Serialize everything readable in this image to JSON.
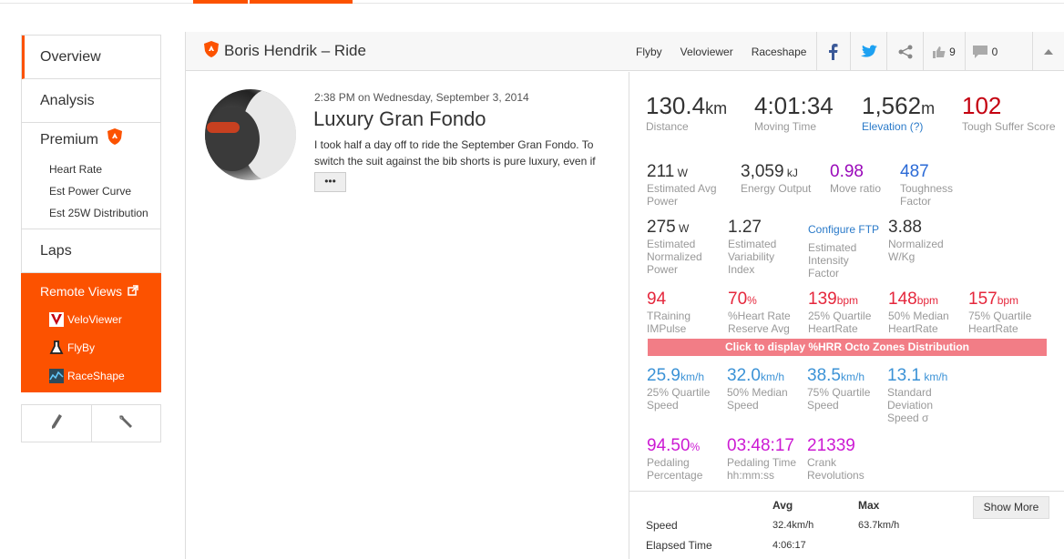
{
  "colors": {
    "accent": "#fc5200",
    "blue_link": "#2a7ac9",
    "suffer_red": "#c40010",
    "hr_red": "#e5273c",
    "purple": "#9a0aba",
    "bar_pink": "#f27d86"
  },
  "sidebar": {
    "overview": "Overview",
    "analysis": "Analysis",
    "premium": "Premium",
    "premium_items": [
      "Heart Rate",
      "Est Power Curve",
      "Est 25W Distribution"
    ],
    "laps": "Laps",
    "remote_title": "Remote Views",
    "remote_items": [
      "VeloViewer",
      "FlyBy",
      "RaceShape"
    ],
    "tool_icons": [
      "pencil-icon",
      "wrench-icon"
    ]
  },
  "header": {
    "title": "Boris Hendrik – Ride",
    "links": [
      "Flyby",
      "Veloviewer",
      "Raceshape"
    ],
    "kudos_count": "9",
    "comment_count": "0"
  },
  "activity": {
    "datetime": "2:38 PM on Wednesday, September 3, 2014",
    "title": "Luxury Gran Fondo",
    "description": "I took half a day off to ride the September Gran Fondo. To switch the suit against the bib shorts is pure luxury, even if",
    "more": "•••"
  },
  "stats": {
    "distance": {
      "value": "130.4",
      "unit": "km",
      "label": "Distance"
    },
    "moving_time": {
      "value": "4:01:34",
      "label": "Moving Time"
    },
    "elevation": {
      "value": "1,562",
      "unit": "m",
      "label": "Elevation (?)"
    },
    "suffer": {
      "value": "102",
      "label": "Tough Suffer Score"
    },
    "row2": [
      {
        "value": "211",
        "unit": "W",
        "label": "Estimated Avg Power"
      },
      {
        "value": "3,059",
        "unit": "kJ",
        "label": "Energy Output"
      },
      {
        "value": "0.98",
        "unit": "",
        "label": "Move ratio"
      },
      {
        "value": "487",
        "unit": "",
        "label": "Toughness Factor"
      }
    ],
    "row3": [
      {
        "value": "275",
        "unit": "W",
        "label": "Estimated Normalized Power"
      },
      {
        "value": "1.27",
        "unit": "",
        "label": "Estimated Variability Index"
      },
      {
        "value": "Configure FTP",
        "unit": "",
        "label": "Estimated Intensity Factor"
      },
      {
        "value": "3.88",
        "unit": "",
        "label": "Normalized W/Kg"
      }
    ],
    "row4": [
      {
        "value": "94",
        "unit": "",
        "label": "TRaining IMPulse"
      },
      {
        "value": "70",
        "unit": "%",
        "label": "%Heart Rate Reserve Avg"
      },
      {
        "value": "139",
        "unit": "bpm",
        "label": "25% Quartile HeartRate"
      },
      {
        "value": "148",
        "unit": "bpm",
        "label": "50% Median HeartRate"
      },
      {
        "value": "157",
        "unit": "bpm",
        "label": "75% Quartile HeartRate"
      }
    ],
    "hrr_button": "Click to display %HRR Octo Zones Distribution",
    "row5": [
      {
        "value": "25.9",
        "unit": "km/h",
        "label": "25% Quartile Speed"
      },
      {
        "value": "32.0",
        "unit": "km/h",
        "label": "50% Median Speed"
      },
      {
        "value": "38.5",
        "unit": "km/h",
        "label": "75% Quartile Speed"
      },
      {
        "value": "13.1",
        "unit": "km/h",
        "label": "Standard Deviation Speed σ"
      }
    ],
    "row6": [
      {
        "value": "94.50",
        "unit": "%",
        "label": "Pedaling Percentage"
      },
      {
        "value": "03:48:17",
        "unit": "",
        "label": "Pedaling Time hh:mm:ss"
      },
      {
        "value": "21339",
        "unit": "",
        "label": "Crank Revolutions"
      }
    ]
  },
  "table": {
    "headers": [
      "Avg",
      "Max"
    ],
    "rows": [
      {
        "label": "Speed",
        "avg": "32.4km/h",
        "max": "63.7km/h"
      },
      {
        "label": "Elapsed Time",
        "avg": "4:06:17",
        "max": ""
      }
    ],
    "show_more": "Show More"
  }
}
